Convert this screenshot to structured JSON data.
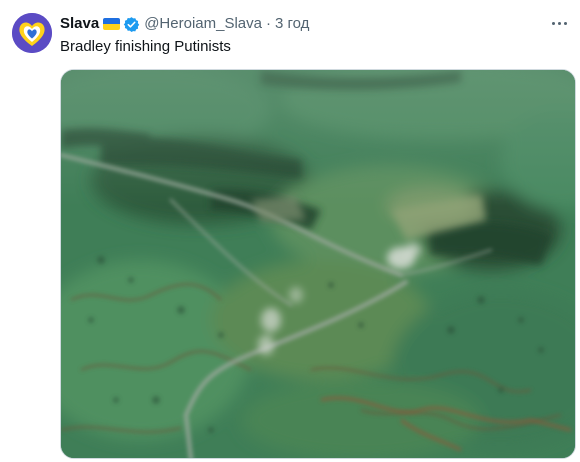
{
  "tweet": {
    "author_name": "Slava",
    "author_handle": "@Heroiam_Slava",
    "separator": "·",
    "timestamp": "3 год",
    "text": "Bradley finishing Putinists",
    "flag": "ukraine-flag",
    "verified_icon": "verified-badge-icon",
    "more_icon": "more-options-icon"
  },
  "colors": {
    "avatar_bg": "#5b4bc4",
    "verified": "#1d9bf0",
    "flag_blue": "#1f6fe0",
    "flag_yellow": "#ffd21a",
    "text_primary": "#0f1419",
    "text_secondary": "#536471"
  },
  "media": {
    "type": "video",
    "content": "aerial-field-road-smoke"
  }
}
